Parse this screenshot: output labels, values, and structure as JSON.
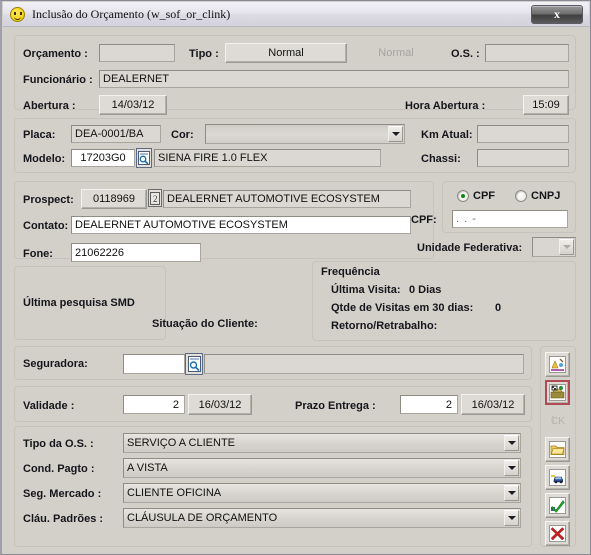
{
  "window": {
    "title": "Inclusão do Orçamento (w_sof_or_clink)",
    "icon": "smiley-icon",
    "close_label": "x"
  },
  "colors": {
    "form_background": "#d3d0ca",
    "field_background": "#dbd8d3",
    "editable_background": "#ffffff",
    "titlebar": "#e6e5ec",
    "radio_selected": "#128512",
    "selected_button_border": "#b04a55"
  },
  "form": {
    "orcamento": {
      "label": "Orçamento :",
      "value": ""
    },
    "tipo": {
      "label": "Tipo :",
      "value": "Normal",
      "secondary_value": "Normal"
    },
    "os": {
      "label": "O.S. :",
      "value": ""
    },
    "funcionario": {
      "label": "Funcionário :",
      "value": "DEALERNET"
    },
    "abertura": {
      "label": "Abertura :",
      "value": "14/03/12"
    },
    "hora_abertura": {
      "label": "Hora Abertura :",
      "value": "15:09"
    },
    "placa": {
      "label": "Placa:",
      "value": "DEA-0001/BA"
    },
    "cor": {
      "label": "Cor:",
      "value": ""
    },
    "km_atual": {
      "label": "Km Atual:",
      "value": ""
    },
    "modelo": {
      "label": "Modelo:",
      "code": "17203G0",
      "description": "SIENA FIRE 1.0 FLEX"
    },
    "chassi": {
      "label": "Chassi:",
      "value": ""
    },
    "prospect": {
      "label": "Prospect:",
      "code": "0118969",
      "description": "DEALERNET AUTOMOTIVE ECOSYSTEM"
    },
    "contato": {
      "label": "Contato:",
      "value": "DEALERNET AUTOMOTIVE ECOSYSTEM"
    },
    "fone": {
      "label": "Fone:",
      "value": "21062226"
    },
    "pessoa_tipo": {
      "options": [
        {
          "label": "CPF",
          "selected": true
        },
        {
          "label": "CNPJ",
          "selected": false
        }
      ]
    },
    "cpf": {
      "label": "CPF:",
      "value": ".   .   -"
    },
    "unidade_federativa": {
      "label": "Unidade Federativa:",
      "value": ""
    },
    "ultima_pesquisa_smd": {
      "label": "Última pesquisa SMD"
    },
    "situacao_cliente": {
      "label": "Situação do Cliente:",
      "value": ""
    },
    "frequencia": {
      "title": "Frequência",
      "ultima_visita": {
        "label": "Última Visita:",
        "value": "0 Dias"
      },
      "qtde_visitas": {
        "label": "Qtde de Visitas em 30 dias:",
        "value": "0"
      },
      "retorno_retrabalho": {
        "label": "Retorno/Retrabalho:",
        "value": ""
      }
    },
    "seguradora": {
      "label": "Seguradora:",
      "code": "",
      "description": ""
    },
    "validade": {
      "label": "Validade :",
      "days": "2",
      "date": "16/03/12"
    },
    "prazo_entrega": {
      "label": "Prazo Entrega :",
      "days": "2",
      "date": "16/03/12"
    },
    "tipo_os": {
      "label": "Tipo da O.S. :",
      "value": "SERVIÇO A CLIENTE"
    },
    "cond_pagto": {
      "label": "Cond. Pagto :",
      "value": "A VISTA"
    },
    "seg_mercado": {
      "label": "Seg. Mercado :",
      "value": "CLIENTE OFICINA"
    },
    "clau_padroes": {
      "label": "Cláu. Padrões :",
      "value": "CLÁUSULA DE ORÇAMENTO"
    }
  },
  "toolbar": {
    "buttons": [
      {
        "name": "paint-palette-icon",
        "enabled": true,
        "selected": false
      },
      {
        "name": "toolbox-icon",
        "enabled": true,
        "selected": true
      },
      {
        "name": "check-lock-icon",
        "enabled": false,
        "selected": false,
        "label": "CK"
      },
      {
        "name": "open-folder-icon",
        "enabled": true,
        "selected": false
      },
      {
        "name": "car-icon",
        "enabled": true,
        "selected": false
      },
      {
        "name": "green-check-icon",
        "enabled": true,
        "selected": false
      },
      {
        "name": "red-x-icon",
        "enabled": true,
        "selected": false
      }
    ]
  }
}
